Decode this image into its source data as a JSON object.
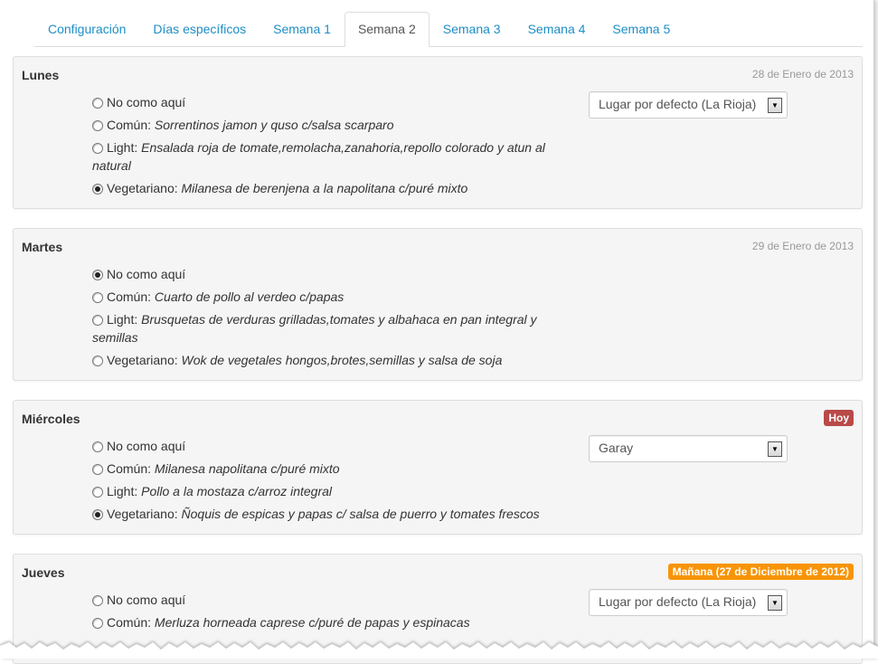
{
  "tabs": [
    {
      "label": "Configuración",
      "active": false
    },
    {
      "label": "Días específicos",
      "active": false
    },
    {
      "label": "Semana 1",
      "active": false
    },
    {
      "label": "Semana 2",
      "active": true
    },
    {
      "label": "Semana 3",
      "active": false
    },
    {
      "label": "Semana 4",
      "active": false
    },
    {
      "label": "Semana 5",
      "active": false
    }
  ],
  "days": [
    {
      "name": "Lunes",
      "date": "28 de Enero de 2013",
      "location": "Lugar por defecto (La Rioja)",
      "options": [
        {
          "label": "No como aquí",
          "dish": "",
          "checked": false
        },
        {
          "label": "Común:",
          "dish": "Sorrentinos jamon y quso c/salsa scarparo",
          "checked": false
        },
        {
          "label": "Light:",
          "dish": "Ensalada roja de tomate,remolacha,zanahoria,repollo colorado y atun al natural",
          "checked": false
        },
        {
          "label": "Vegetariano:",
          "dish": "Milanesa de berenjena a la napolitana c/puré mixto",
          "checked": true
        }
      ]
    },
    {
      "name": "Martes",
      "date": "29 de Enero de 2013",
      "options": [
        {
          "label": "No como aquí",
          "dish": "",
          "checked": true
        },
        {
          "label": "Común:",
          "dish": "Cuarto de pollo al verdeo c/papas",
          "checked": false
        },
        {
          "label": "Light:",
          "dish": "Brusquetas de verduras grilladas,tomates y albahaca en pan integral y semillas",
          "checked": false
        },
        {
          "label": "Vegetariano:",
          "dish": "Wok de vegetales hongos,brotes,semillas y salsa de soja",
          "checked": false
        }
      ]
    },
    {
      "name": "Miércoles",
      "badge": "Hoy",
      "badge_color": "#b94a48",
      "location": "Garay",
      "options": [
        {
          "label": "No como aquí",
          "dish": "",
          "checked": false
        },
        {
          "label": "Común:",
          "dish": "Milanesa napolitana c/puré mixto",
          "checked": false
        },
        {
          "label": "Light:",
          "dish": "Pollo a la mostaza c/arroz integral",
          "checked": false
        },
        {
          "label": "Vegetariano:",
          "dish": "Ñoquis de espicas y papas c/ salsa de puerro y tomates frescos",
          "checked": true
        }
      ]
    },
    {
      "name": "Jueves",
      "badge": "Mañana (27 de Diciembre de 2012)",
      "badge_color": "#f89406",
      "location": "Lugar por defecto (La Rioja)",
      "options": [
        {
          "label": "No como aquí",
          "dish": "",
          "checked": false
        },
        {
          "label": "Común:",
          "dish": "Merluza horneada caprese c/puré de papas y espinacas",
          "checked": false
        }
      ]
    }
  ],
  "colors": {
    "link": "#1e8ec5",
    "panel_bg": "#f5f5f5",
    "today_badge": "#b94a48",
    "tomorrow_badge": "#f89406"
  }
}
